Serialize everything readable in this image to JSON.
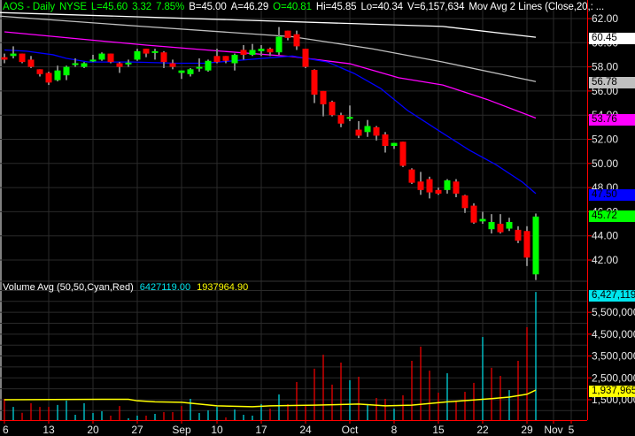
{
  "header": {
    "symbol": "AOS - Daily",
    "exchange": "NYSE",
    "last": "L=45.60",
    "change": "3.32",
    "change_pct": "7.85%",
    "bid": "B=45.00",
    "ask": "A=46.29",
    "open": "O=40.81",
    "high": "Hi=45.85",
    "low": "Lo=40.34",
    "volume": "V=6,157,634",
    "study": "Mov Avg 2 Lines (Close,20,: ..."
  },
  "volume_header": {
    "label": "Volume Avg (50,50,Cyan,Red)",
    "volume_value": "6427119.00",
    "avg_value": "1937964.90"
  },
  "colors": {
    "up": "#00ff00",
    "down": "#ff0000",
    "wick": "#808080",
    "ma_white": "#ffffff",
    "ma_gray": "#c0c0c0",
    "ma_magenta": "#ff00ff",
    "ma_blue": "#0000ff",
    "vol_up": "#00e5ee",
    "vol_down": "#ff0000",
    "vol_avg": "#ffff00",
    "axis": "#ff0000",
    "grid": "#2a2a2a"
  },
  "price_tags": [
    {
      "value": "60.45",
      "color": "#ffffff"
    },
    {
      "value": "56.78",
      "color": "#c0c0c0"
    },
    {
      "value": "53.76",
      "color": "#ff00ff"
    },
    {
      "value": "47.50",
      "color": "#0000ff"
    },
    {
      "value": "45.72",
      "color": "#00ff00"
    }
  ],
  "volume_tags": [
    {
      "value": "6,427,119",
      "color": "#00e5ee"
    },
    {
      "value": "1,937,965",
      "color": "#ffff00"
    }
  ],
  "chart_data": {
    "type": "candlestick",
    "price_axis": {
      "ylim": [
        40,
        63.3
      ],
      "ticks": [
        "62.00",
        "60.00",
        "58.00",
        "56.00",
        "54.00",
        "52.00",
        "50.00",
        "48.00",
        "46.00",
        "44.00",
        "42.00"
      ]
    },
    "volume_axis": {
      "ylim_millions": [
        0.6,
        6.6
      ],
      "ticks": [
        "5,500,000",
        "4,500,000",
        "3,500,000",
        "2,500,000",
        "1,500,000"
      ]
    },
    "x_labels": [
      {
        "text": "6",
        "index": 0
      },
      {
        "text": "13",
        "index": 5
      },
      {
        "text": "20",
        "index": 10
      },
      {
        "text": "27",
        "index": 15
      },
      {
        "text": "Sep",
        "index": 20
      },
      {
        "text": "10",
        "index": 24
      },
      {
        "text": "17",
        "index": 29
      },
      {
        "text": "24",
        "index": 34
      },
      {
        "text": "Oct",
        "index": 39
      },
      {
        "text": "8",
        "index": 44
      },
      {
        "text": "15",
        "index": 49
      },
      {
        "text": "22",
        "index": 54
      },
      {
        "text": "29",
        "index": 59
      },
      {
        "text": "Nov",
        "index": 62
      },
      {
        "text": "5",
        "index": 64
      }
    ],
    "ohlc_fields": [
      "open",
      "high",
      "low",
      "close"
    ],
    "candles": [
      [
        58.8,
        59.1,
        58.3,
        58.6
      ],
      [
        58.9,
        59.7,
        58.7,
        59.1
      ],
      [
        59.1,
        59.1,
        58.3,
        58.4
      ],
      [
        58.6,
        58.9,
        57.9,
        58.0
      ],
      [
        57.8,
        57.8,
        57.2,
        57.4
      ],
      [
        57.5,
        57.6,
        56.5,
        56.7
      ],
      [
        56.9,
        58.1,
        56.8,
        57.7
      ],
      [
        57.3,
        58.1,
        56.9,
        58.0
      ],
      [
        58.25,
        58.7,
        58.0,
        58.3
      ],
      [
        58.0,
        58.4,
        57.9,
        58.3
      ],
      [
        58.5,
        59.0,
        58.4,
        58.6
      ],
      [
        58.6,
        59.2,
        58.5,
        59.1
      ],
      [
        59.1,
        59.1,
        58.3,
        58.4
      ],
      [
        58.3,
        58.4,
        57.5,
        58.0
      ],
      [
        58.3,
        58.6,
        58.0,
        58.35
      ],
      [
        58.6,
        59.5,
        58.5,
        59.3
      ],
      [
        59.5,
        59.5,
        58.8,
        59.1
      ],
      [
        59.2,
        59.5,
        58.6,
        59.3
      ],
      [
        59.2,
        59.3,
        57.9,
        58.4
      ],
      [
        58.3,
        58.6,
        57.8,
        58.0
      ],
      [
        57.5,
        57.7,
        57.0,
        57.7
      ],
      [
        57.4,
        57.9,
        57.2,
        57.8
      ],
      [
        57.9,
        58.7,
        57.6,
        58.0
      ],
      [
        57.7,
        58.6,
        57.6,
        58.5
      ],
      [
        58.9,
        59.5,
        58.3,
        58.4
      ],
      [
        58.9,
        58.9,
        58.3,
        58.5
      ],
      [
        58.3,
        59.1,
        57.7,
        59.0
      ],
      [
        59.4,
        59.8,
        58.6,
        59.0
      ],
      [
        59.0,
        59.9,
        58.9,
        59.4
      ],
      [
        59.3,
        59.8,
        58.9,
        59.5
      ],
      [
        59.5,
        59.6,
        58.9,
        59.2
      ],
      [
        59.2,
        61.3,
        59.0,
        60.5
      ],
      [
        61.0,
        61.0,
        60.2,
        60.4
      ],
      [
        60.7,
        61.0,
        59.4,
        59.7
      ],
      [
        59.5,
        59.5,
        57.9,
        58.0
      ],
      [
        57.75,
        57.8,
        55.0,
        55.7
      ],
      [
        56.0,
        56.0,
        53.9,
        54.9
      ],
      [
        55.1,
        55.2,
        53.9,
        54.0
      ],
      [
        54.0,
        54.2,
        53.0,
        53.3
      ],
      [
        53.7,
        54.8,
        53.5,
        53.85
      ],
      [
        52.8,
        53.5,
        52.1,
        52.3
      ],
      [
        52.6,
        53.6,
        52.2,
        53.1
      ],
      [
        53.0,
        53.1,
        51.9,
        52.3
      ],
      [
        52.4,
        52.6,
        50.9,
        51.45
      ],
      [
        51.45,
        51.7,
        51.2,
        51.7
      ],
      [
        51.8,
        51.8,
        49.7,
        49.8
      ],
      [
        49.5,
        49.6,
        48.3,
        48.4
      ],
      [
        48.5,
        49.3,
        47.4,
        47.8
      ],
      [
        48.7,
        48.9,
        47.1,
        47.6
      ],
      [
        47.8,
        48.0,
        47.4,
        47.5
      ],
      [
        47.8,
        48.7,
        47.5,
        48.6
      ],
      [
        48.5,
        48.7,
        47.2,
        47.5
      ],
      [
        47.35,
        47.4,
        45.9,
        46.3
      ],
      [
        46.5,
        46.7,
        45.0,
        45.1
      ],
      [
        45.2,
        46.0,
        45.0,
        45.4
      ],
      [
        44.55,
        45.8,
        44.2,
        45.15
      ],
      [
        45.0,
        45.8,
        44.2,
        44.3
      ],
      [
        44.6,
        45.5,
        44.4,
        45.15
      ],
      [
        44.5,
        44.8,
        43.4,
        43.6
      ],
      [
        44.4,
        44.8,
        41.5,
        42.2
      ],
      [
        40.81,
        45.85,
        40.34,
        45.6
      ]
    ],
    "moving_averages": [
      {
        "name": "white",
        "color": "#ffffff",
        "points": [
          [
            -0.5,
            62.5
          ],
          [
            49.5,
            61.35
          ],
          [
            60,
            60.45
          ]
        ]
      },
      {
        "name": "gray",
        "color": "#c0c0c0",
        "points": [
          [
            -0.5,
            62.2
          ],
          [
            15.6,
            61.35
          ],
          [
            32.5,
            60.5
          ],
          [
            41.5,
            59.5
          ],
          [
            49.5,
            58.4
          ],
          [
            60,
            56.78
          ]
        ]
      },
      {
        "name": "magenta",
        "color": "#ff00ff",
        "points": [
          [
            0,
            60.9
          ],
          [
            9.5,
            60.24
          ],
          [
            16,
            59.8
          ],
          [
            24.5,
            59.3
          ],
          [
            32.5,
            58.85
          ],
          [
            39,
            58.26
          ],
          [
            44.5,
            57.1
          ],
          [
            49.5,
            56.5
          ],
          [
            54.5,
            55.3
          ],
          [
            60,
            53.76
          ]
        ]
      },
      {
        "name": "blue",
        "color": "#0000ff",
        "points": [
          [
            0,
            59.4
          ],
          [
            2.5,
            59.3
          ],
          [
            5.5,
            59.0
          ],
          [
            7,
            58.7
          ],
          [
            9.5,
            58.4
          ],
          [
            14.5,
            58.4
          ],
          [
            19.5,
            58.3
          ],
          [
            22.5,
            58.3
          ],
          [
            27.5,
            58.6
          ],
          [
            32.5,
            58.9
          ],
          [
            36.5,
            58.4
          ],
          [
            39.5,
            57.45
          ],
          [
            42.5,
            56.2
          ],
          [
            45.5,
            54.4
          ],
          [
            49.5,
            52.5
          ],
          [
            52.5,
            51.1
          ],
          [
            55.5,
            49.9
          ],
          [
            58.5,
            48.45
          ],
          [
            60,
            47.5
          ]
        ]
      }
    ],
    "volume_millions": [
      1.54,
      1.17,
      0.9,
      1.34,
      1.17,
      1.17,
      1.26,
      1.46,
      0.81,
      1.34,
      0.89,
      0.97,
      0.77,
      1.21,
      0.65,
      0.77,
      0.77,
      0.85,
      0.93,
      0.93,
      1.21,
      1.54,
      0.89,
      1.01,
      1.17,
      0.69,
      1.05,
      0.81,
      0.77,
      1.3,
      1.09,
      1.74,
      1.3,
      2.31,
      1.21,
      2.92,
      3.56,
      2.19,
      3.2,
      2.39,
      2.55,
      1.3,
      1.58,
      1.54,
      1.09,
      1.7,
      3.28,
      3.93,
      2.83,
      1.82,
      2.71,
      1.46,
      1.86,
      2.27,
      4.37,
      2.96,
      2.59,
      1.94,
      3.28,
      4.82,
      6.43
    ],
    "volume_up": [
      0,
      1,
      0,
      0,
      0,
      0,
      1,
      1,
      1,
      1,
      1,
      1,
      0,
      0,
      1,
      1,
      0,
      1,
      0,
      0,
      0,
      1,
      1,
      1,
      1,
      0,
      1,
      1,
      1,
      1,
      0,
      1,
      0,
      0,
      0,
      0,
      0,
      0,
      0,
      1,
      0,
      1,
      0,
      0,
      1,
      0,
      0,
      0,
      0,
      0,
      1,
      0,
      0,
      0,
      1,
      0,
      0,
      1,
      0,
      0,
      1
    ],
    "volume_avg_millions": [
      [
        0,
        1.5
      ],
      [
        11,
        1.52
      ],
      [
        14,
        1.52
      ],
      [
        15,
        1.45
      ],
      [
        17,
        1.4
      ],
      [
        20,
        1.38
      ],
      [
        22,
        1.3
      ],
      [
        24,
        1.22
      ],
      [
        28,
        1.18
      ],
      [
        30,
        1.22
      ],
      [
        35,
        1.25
      ],
      [
        40,
        1.3
      ],
      [
        43,
        1.22
      ],
      [
        46,
        1.25
      ],
      [
        50,
        1.4
      ],
      [
        55,
        1.55
      ],
      [
        57,
        1.62
      ],
      [
        59,
        1.75
      ],
      [
        60,
        1.94
      ]
    ]
  }
}
